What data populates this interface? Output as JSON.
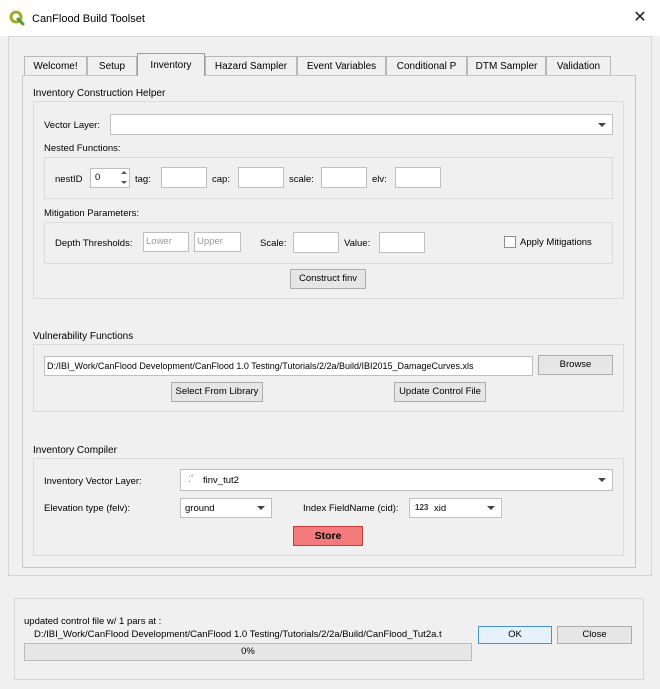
{
  "window": {
    "title": "CanFlood Build Toolset",
    "icon": "qgis-icon",
    "close_icon": "close-icon"
  },
  "tabs": [
    {
      "label": "Welcome!"
    },
    {
      "label": "Setup"
    },
    {
      "label": "Inventory"
    },
    {
      "label": "Hazard Sampler"
    },
    {
      "label": "Event Variables"
    },
    {
      "label": "Conditional P"
    },
    {
      "label": "DTM Sampler"
    },
    {
      "label": "Validation"
    }
  ],
  "active_tab": "Inventory",
  "construction": {
    "title": "Inventory Construction Helper",
    "vector_layer_label": "Vector Layer:",
    "vector_layer_value": "",
    "nested_label": "Nested Functions:",
    "nestid_label": "nestID",
    "nestid_value": "0",
    "tag_label": "tag:",
    "cap_label": "cap:",
    "scale_label": "scale:",
    "elv_label": "elv:",
    "mitigation_label": "Mitigation Parameters:",
    "depth_label": "Depth Thresholds:",
    "lower_placeholder": "Lower",
    "upper_placeholder": "Upper",
    "mit_scale_label": "Scale:",
    "value_label": "Value:",
    "apply_label": "Apply Mitigations",
    "apply_checked": false,
    "construct_button": "Construct finv"
  },
  "vulnerability": {
    "title": "Vulnerability Functions",
    "path": "D:/IBI_Work/CanFlood Development/CanFlood 1.0 Testing/Tutorials/2/2a/Build/IBI2015_DamageCurves.xls",
    "browse_button": "Browse",
    "library_button": "Select From Library",
    "update_button": "Update Control File"
  },
  "compiler": {
    "title": "Inventory Compiler",
    "layer_label": "Inventory Vector Layer:",
    "layer_value": "finv_tut2",
    "elevation_label": "Elevation type (felv):",
    "elevation_value": "ground",
    "index_label": "Index FieldName (cid):",
    "index_value": "xid",
    "index_type_badge": "123",
    "store_button": "Store"
  },
  "status": {
    "message_line1": "updated control file w/ 1 pars at :",
    "message_line2": "D:/IBI_Work/CanFlood Development/CanFlood 1.0 Testing/Tutorials/2/2a/Build/CanFlood_Tut2a.t",
    "ok_button": "OK",
    "close_button": "Close",
    "progress_text": "0%",
    "progress_value": 0
  }
}
